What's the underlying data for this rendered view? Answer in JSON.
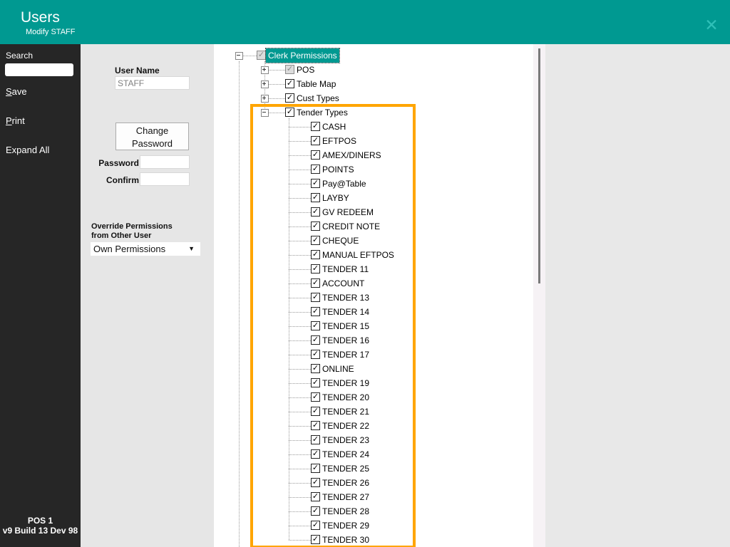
{
  "header": {
    "title": "Users",
    "subtitle": "Modify STAFF"
  },
  "sidebar": {
    "search_label": "Search",
    "search_value": "",
    "actions": [
      {
        "accel": "S",
        "rest": "ave"
      },
      {
        "accel": "P",
        "rest": "rint"
      },
      {
        "accel": "",
        "rest": "Expand All"
      }
    ],
    "footer_line1": "POS 1",
    "footer_line2": "v9 Build 13 Dev 98"
  },
  "form": {
    "username_label": "User Name",
    "username_value": "STAFF",
    "change_password_button": "Change Password",
    "password_label": "Password",
    "password_value": "",
    "confirm_label": "Confirm",
    "confirm_value": "",
    "override_label_line1": "Override Permissions",
    "override_label_line2": "from Other User",
    "override_value": "Own Permissions"
  },
  "tree": {
    "nodes": [
      {
        "label": "Clerk Permissions",
        "level": 0,
        "expander": "minus",
        "check": "partial",
        "selected": true
      },
      {
        "label": "POS",
        "level": 1,
        "expander": "plus",
        "check": "partial"
      },
      {
        "label": "Table Map",
        "level": 1,
        "expander": "plus",
        "check": "checked"
      },
      {
        "label": "Cust Types",
        "level": 1,
        "expander": "plus",
        "check": "checked"
      },
      {
        "label": "Tender Types",
        "level": 1,
        "expander": "minus",
        "check": "checked"
      },
      {
        "label": "CASH",
        "level": 2,
        "check": "checked"
      },
      {
        "label": "EFTPOS",
        "level": 2,
        "check": "checked"
      },
      {
        "label": "AMEX/DINERS",
        "level": 2,
        "check": "checked"
      },
      {
        "label": "POINTS",
        "level": 2,
        "check": "checked"
      },
      {
        "label": "Pay@Table",
        "level": 2,
        "check": "checked"
      },
      {
        "label": "LAYBY",
        "level": 2,
        "check": "checked"
      },
      {
        "label": "GV REDEEM",
        "level": 2,
        "check": "checked"
      },
      {
        "label": "CREDIT NOTE",
        "level": 2,
        "check": "checked"
      },
      {
        "label": "CHEQUE",
        "level": 2,
        "check": "checked"
      },
      {
        "label": "MANUAL EFTPOS",
        "level": 2,
        "check": "checked"
      },
      {
        "label": "TENDER 11",
        "level": 2,
        "check": "checked"
      },
      {
        "label": "ACCOUNT",
        "level": 2,
        "check": "checked"
      },
      {
        "label": "TENDER 13",
        "level": 2,
        "check": "checked"
      },
      {
        "label": "TENDER 14",
        "level": 2,
        "check": "checked"
      },
      {
        "label": "TENDER 15",
        "level": 2,
        "check": "checked"
      },
      {
        "label": "TENDER 16",
        "level": 2,
        "check": "checked"
      },
      {
        "label": "TENDER 17",
        "level": 2,
        "check": "checked"
      },
      {
        "label": "ONLINE",
        "level": 2,
        "check": "checked"
      },
      {
        "label": "TENDER 19",
        "level": 2,
        "check": "checked"
      },
      {
        "label": "TENDER 20",
        "level": 2,
        "check": "checked"
      },
      {
        "label": "TENDER 21",
        "level": 2,
        "check": "checked"
      },
      {
        "label": "TENDER 22",
        "level": 2,
        "check": "checked"
      },
      {
        "label": "TENDER 23",
        "level": 2,
        "check": "checked"
      },
      {
        "label": "TENDER 24",
        "level": 2,
        "check": "checked"
      },
      {
        "label": "TENDER 25",
        "level": 2,
        "check": "checked"
      },
      {
        "label": "TENDER 26",
        "level": 2,
        "check": "checked"
      },
      {
        "label": "TENDER 27",
        "level": 2,
        "check": "checked"
      },
      {
        "label": "TENDER 28",
        "level": 2,
        "check": "checked"
      },
      {
        "label": "TENDER 29",
        "level": 2,
        "check": "checked"
      },
      {
        "label": "TENDER 30",
        "level": 2,
        "check": "checked"
      }
    ]
  },
  "colors": {
    "accent_teal": "#009991",
    "sidebar_dark": "#262626",
    "panel_gray": "#e6e6e6",
    "highlight_orange": "#ffa500"
  },
  "icons": {
    "close": "✕",
    "dropdown_arrow": "▼",
    "checkmark": "✓"
  }
}
